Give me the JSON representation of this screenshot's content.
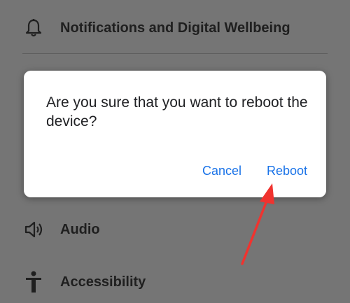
{
  "settings": {
    "items": [
      {
        "label": "Notifications and Digital Wellbeing",
        "icon": "bell-icon"
      },
      {
        "label": "Audio",
        "icon": "speaker-icon"
      },
      {
        "label": "Accessibility",
        "icon": "accessibility-icon"
      }
    ]
  },
  "dialog": {
    "message": "Are you sure that you want to reboot the device?",
    "cancel_label": "Cancel",
    "confirm_label": "Reboot"
  },
  "annotation": {
    "arrow_color": "#f0332f",
    "target": "Reboot"
  },
  "colors": {
    "accent": "#1a73e8",
    "overlay": "#757575"
  }
}
